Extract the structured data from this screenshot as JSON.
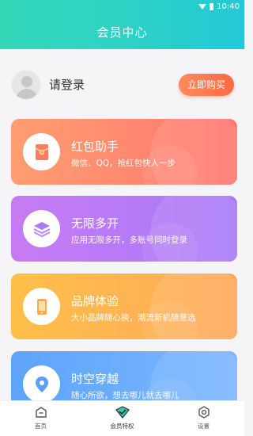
{
  "status_bar": {
    "time": "10:40"
  },
  "header": {
    "title": "会员中心"
  },
  "user": {
    "login_text": "请登录",
    "buy_button": "立即购买"
  },
  "cards": [
    {
      "title": "红包助手",
      "subtitle": "微信、QQ，抢红包快人一步",
      "icon": "red-envelope-icon",
      "color_start": "#ff9e70",
      "color_end": "#ff7670"
    },
    {
      "title": "无限多开",
      "subtitle": "应用无限多开，多账号同时登录",
      "icon": "layers-icon",
      "color_start": "#c77bf4",
      "color_end": "#a87af8"
    },
    {
      "title": "品牌体验",
      "subtitle": "大小品牌随心换，潮流新机随意选",
      "icon": "phone-icon",
      "color_start": "#ffc04a",
      "color_end": "#ffa85a"
    },
    {
      "title": "时空穿越",
      "subtitle": "随心所欲，想去哪儿就去哪儿",
      "icon": "location-pin-icon",
      "color_start": "#5ea4fa",
      "color_end": "#7bb7ff"
    }
  ],
  "tabbar": [
    {
      "label": "首页",
      "icon": "home-icon"
    },
    {
      "label": "会员特权",
      "icon": "vip-shield-icon",
      "active": true
    },
    {
      "label": "设置",
      "icon": "settings-icon"
    }
  ]
}
